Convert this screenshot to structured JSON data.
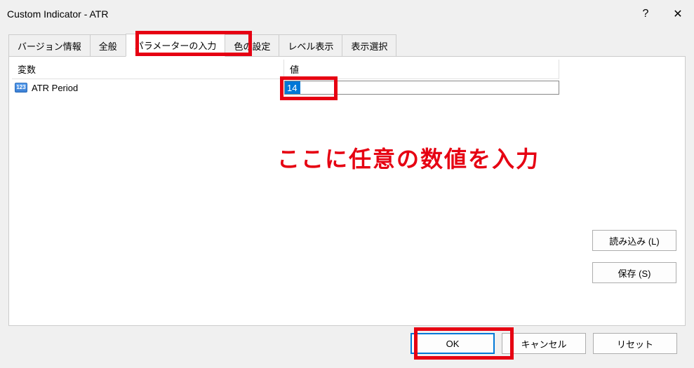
{
  "titlebar": {
    "title": "Custom Indicator - ATR",
    "help": "?",
    "close": "✕"
  },
  "tabs": {
    "version": "バージョン情報",
    "general": "全般",
    "params": "パラメーターの入力",
    "colors": "色の設定",
    "levels": "レベル表示",
    "display": "表示選択"
  },
  "table": {
    "header_var": "変数",
    "header_val": "値",
    "row0": {
      "name": "ATR Period",
      "value": "14",
      "icon_text": "123"
    }
  },
  "annotation": {
    "text": "ここに任意の数値を入力"
  },
  "sidebtns": {
    "load": "読み込み (L)",
    "save": "保存 (S)"
  },
  "footer": {
    "ok": "OK",
    "cancel": "キャンセル",
    "reset": "リセット"
  }
}
